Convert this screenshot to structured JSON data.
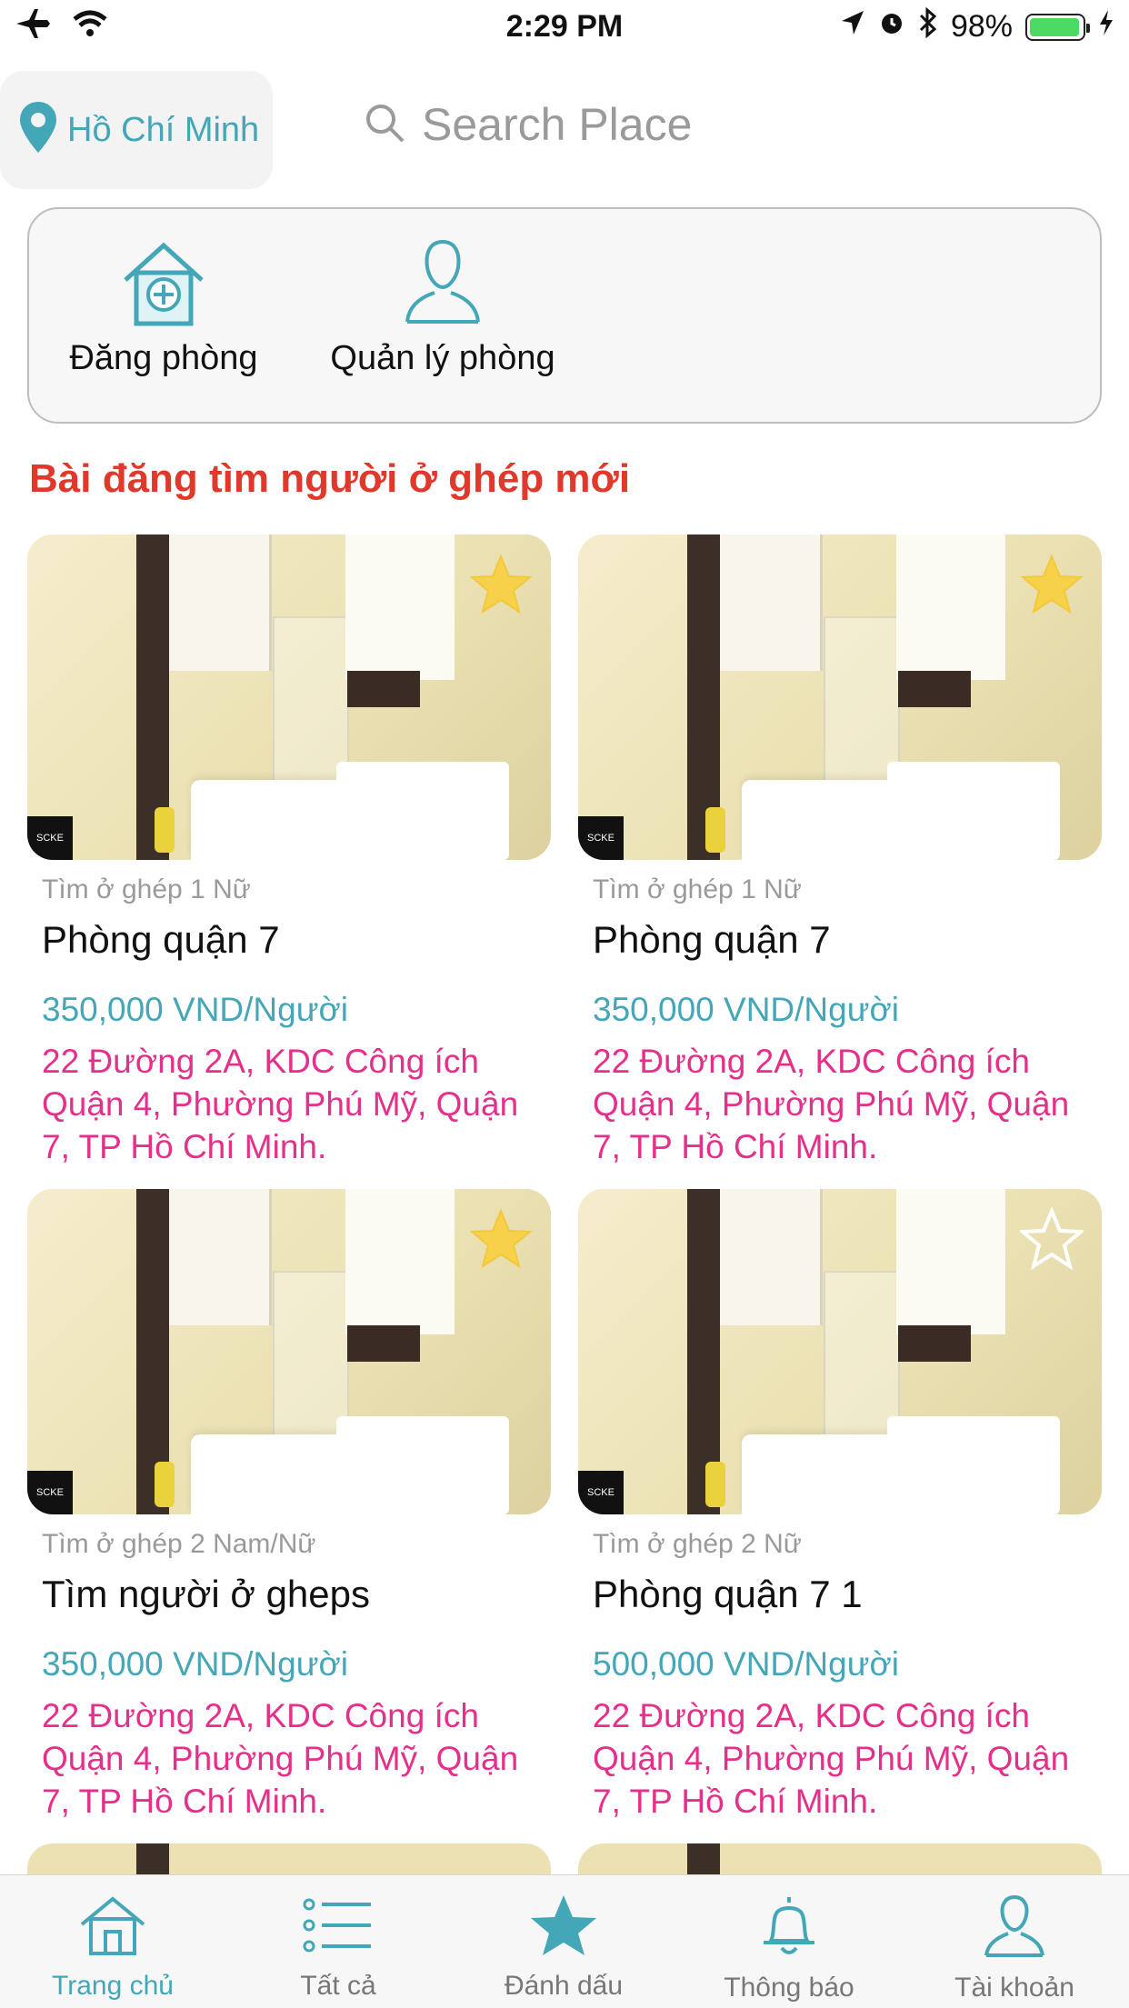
{
  "status_bar": {
    "time": "2:29 PM",
    "battery": "98%"
  },
  "location": {
    "city": "Hồ Chí Minh"
  },
  "search": {
    "placeholder": "Search Place"
  },
  "actions": {
    "post_room": "Đăng phòng",
    "manage_rooms": "Quản lý phòng"
  },
  "section_title": "Bài đăng tìm người ở ghép mới",
  "listings": [
    {
      "meta": "Tìm ở ghép 1 Nữ",
      "title": "Phòng quận 7",
      "price": "350,000 VND/Người",
      "address": "22 Đường 2A, KDC Công ích Quận 4, Phường Phú Mỹ, Quận 7, TP Hồ Chí Minh.",
      "favorited": true
    },
    {
      "meta": "Tìm ở ghép 1 Nữ",
      "title": "Phòng quận 7",
      "price": "350,000 VND/Người",
      "address": "22 Đường 2A, KDC Công ích Quận 4, Phường Phú Mỹ, Quận 7, TP Hồ Chí Minh.",
      "favorited": true
    },
    {
      "meta": "Tìm ở ghép 2 Nam/Nữ",
      "title": "Tìm người ở gheps",
      "price": "350,000 VND/Người",
      "address": "22 Đường 2A, KDC Công ích Quận 4, Phường Phú Mỹ, Quận 7, TP Hồ Chí Minh.",
      "favorited": true
    },
    {
      "meta": "Tìm ở ghép 2 Nữ",
      "title": "Phòng quận 7 1",
      "price": "500,000 VND/Người",
      "address": "22 Đường 2A, KDC Công ích Quận 4, Phường Phú Mỹ, Quận 7, TP Hồ Chí Minh.",
      "favorited": false
    }
  ],
  "tabs": [
    {
      "label": "Trang chủ",
      "icon": "home-icon"
    },
    {
      "label": "Tất cả",
      "icon": "list-icon"
    },
    {
      "label": "Đánh dấu",
      "icon": "star-icon"
    },
    {
      "label": "Thông báo",
      "icon": "bell-icon"
    },
    {
      "label": "Tài khoản",
      "icon": "user-icon"
    }
  ],
  "colors": {
    "accent": "#44a7b8",
    "section_title": "#e0392b",
    "address": "#e52f8a",
    "star": "#f7d14a"
  }
}
